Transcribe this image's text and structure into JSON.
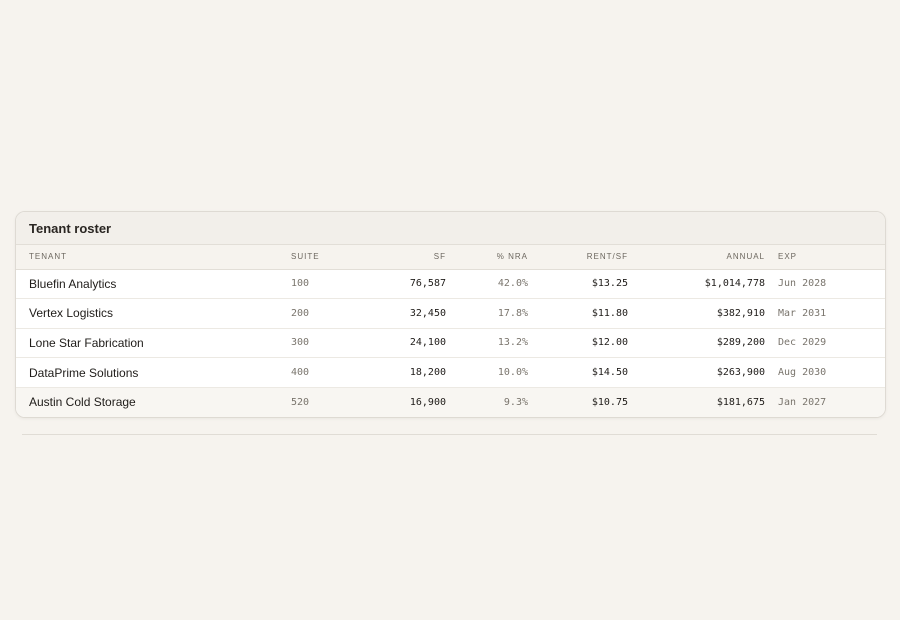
{
  "roster": {
    "title": "Tenant roster",
    "columns": {
      "tenant": "TENANT",
      "suite": "SUITE",
      "sf": "SF",
      "nra": "% NRA",
      "rent": "RENT/SF",
      "annual": "ANNUAL",
      "exp": "EXP"
    },
    "rows": [
      {
        "tenant": "Bluefin Analytics",
        "suite": "100",
        "sf": "76,587",
        "nra": "42.0%",
        "rent": "$13.25",
        "annual": "$1,014,778",
        "exp": "Jun 2028"
      },
      {
        "tenant": "Vertex Logistics",
        "suite": "200",
        "sf": "32,450",
        "nra": "17.8%",
        "rent": "$11.80",
        "annual": "$382,910",
        "exp": "Mar 2031"
      },
      {
        "tenant": "Lone Star Fabrication",
        "suite": "300",
        "sf": "24,100",
        "nra": "13.2%",
        "rent": "$12.00",
        "annual": "$289,200",
        "exp": "Dec 2029"
      },
      {
        "tenant": "DataPrime Solutions",
        "suite": "400",
        "sf": "18,200",
        "nra": "10.0%",
        "rent": "$14.50",
        "annual": "$263,900",
        "exp": "Aug 2030"
      },
      {
        "tenant": "Austin Cold Storage",
        "suite": "520",
        "sf": "16,900",
        "nra": "9.3%",
        "rent": "$10.75",
        "annual": "$181,675",
        "exp": "Jan 2027"
      }
    ]
  },
  "colors": {
    "background": "#f6f3ee",
    "card": "#ffffff",
    "header": "#f2efea",
    "text": "#1f1c19",
    "muted": "#7a756d"
  }
}
